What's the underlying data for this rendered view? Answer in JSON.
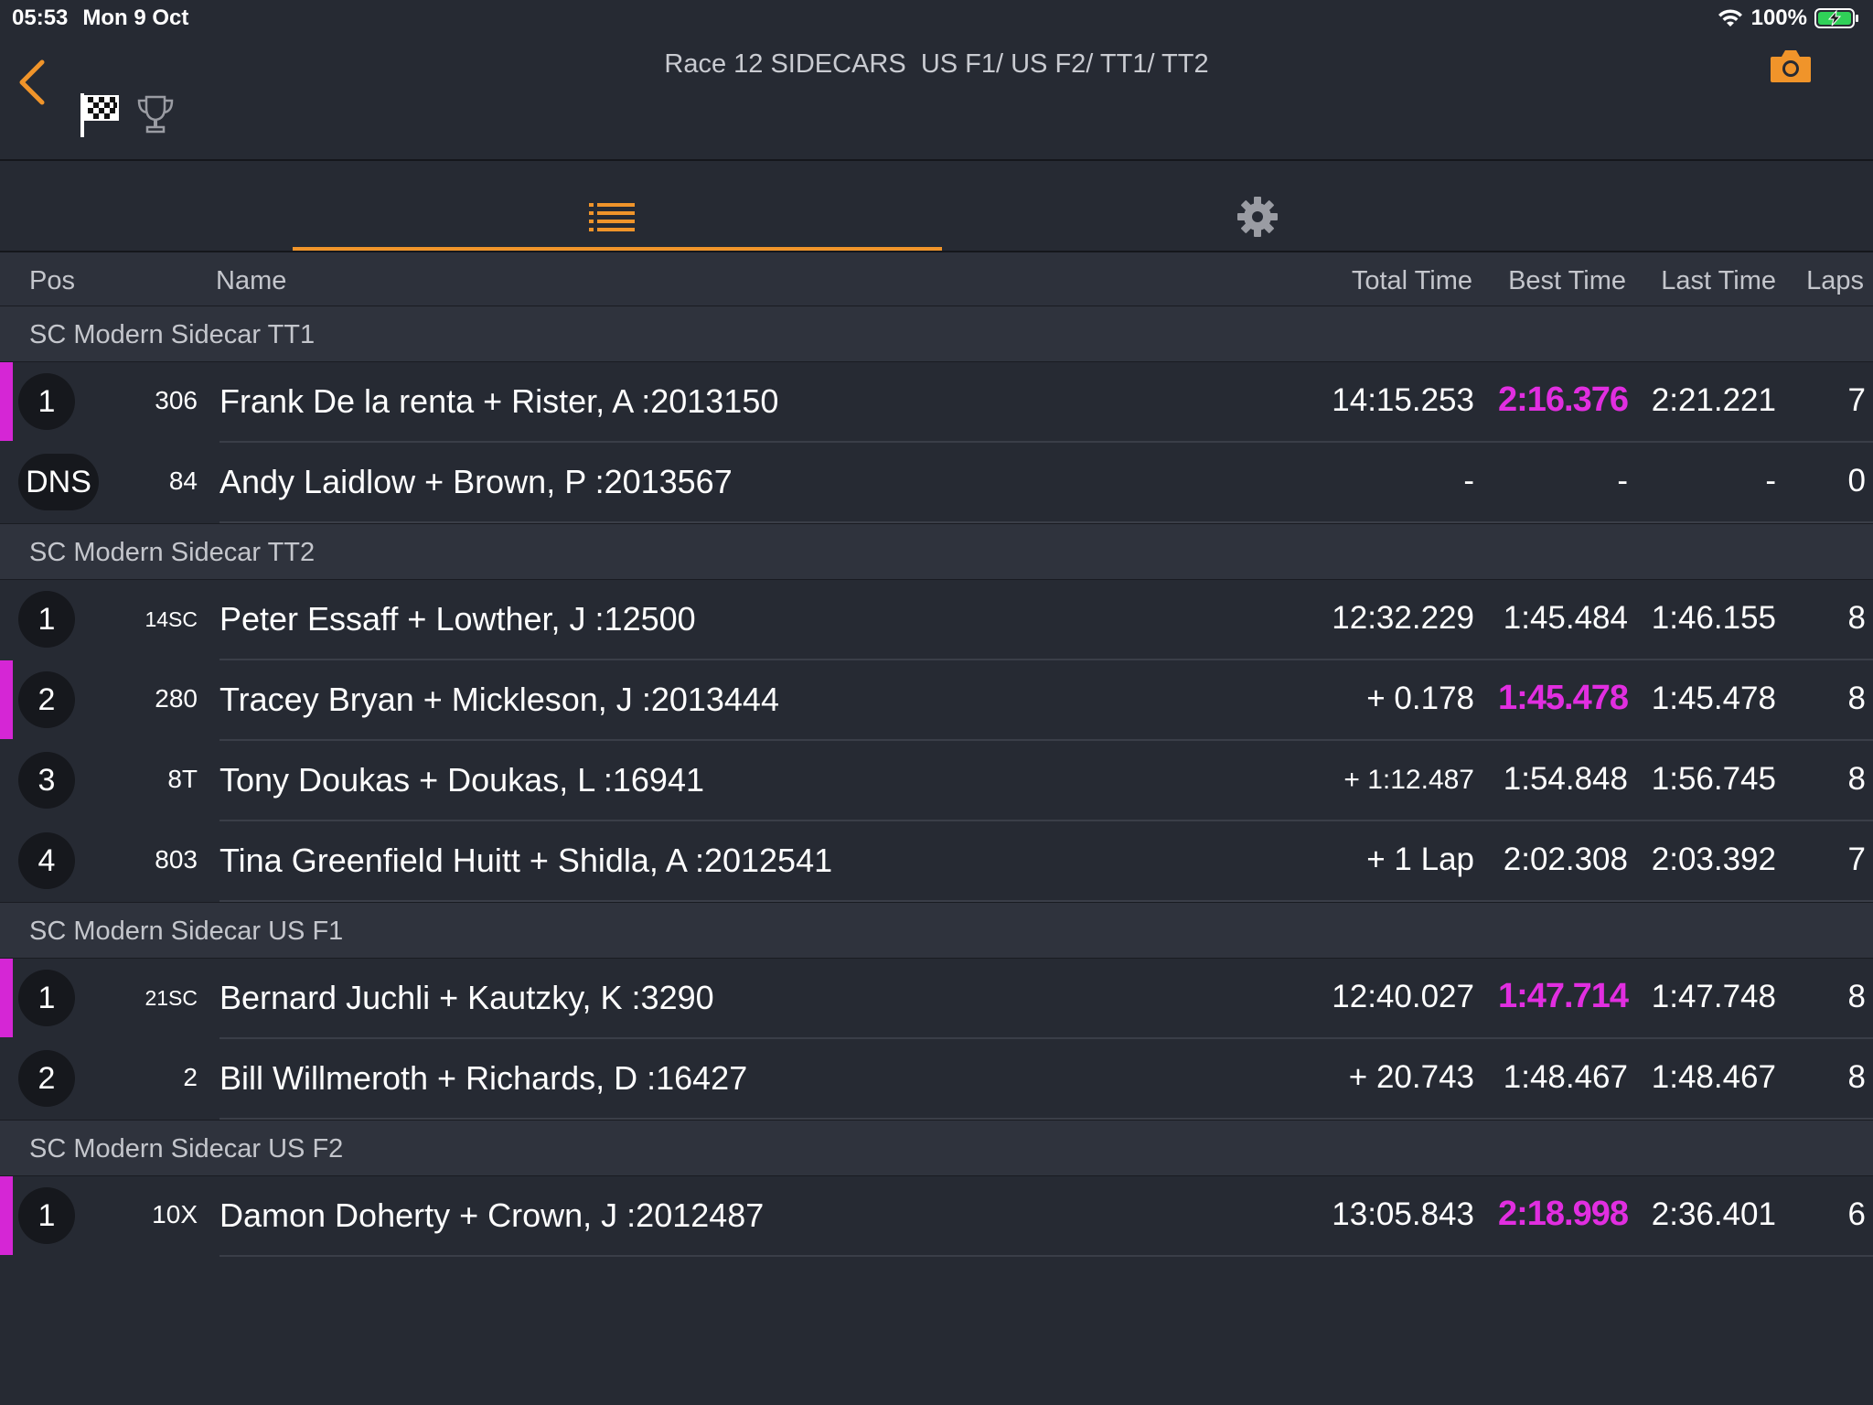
{
  "status_bar": {
    "time": "05:53",
    "date": "Mon 9 Oct",
    "battery": "100%"
  },
  "header": {
    "title": "Race 12 SIDECARS  US F1/ US F2/ TT1/ TT2"
  },
  "columns": {
    "pos": "Pos",
    "name": "Name",
    "total": "Total Time",
    "best": "Best Time",
    "last": "Last Time",
    "laps": "Laps"
  },
  "colors": {
    "accent": "#f0942a",
    "fastest": "#e12ee0",
    "background": "#262a33"
  },
  "classes": [
    {
      "name": "SC Modern Sidecar TT1",
      "rows": [
        {
          "pos": "1",
          "number": "306",
          "name": "Frank De la renta + Rister, A :2013150",
          "total": "14:15.253",
          "best": "2:16.376",
          "last": "2:21.221",
          "laps": "7",
          "fastest": true
        },
        {
          "pos": "DNS",
          "number": "84",
          "name": "Andy Laidlow + Brown, P :2013567",
          "total": "-",
          "best": "-",
          "last": "-",
          "laps": "0",
          "fastest": false
        }
      ]
    },
    {
      "name": "SC Modern Sidecar TT2",
      "rows": [
        {
          "pos": "1",
          "number": "14SC",
          "name": "Peter Essaff + Lowther, J :12500",
          "total": "12:32.229",
          "best": "1:45.484",
          "last": "1:46.155",
          "laps": "8",
          "fastest": false
        },
        {
          "pos": "2",
          "number": "280",
          "name": "Tracey Bryan + Mickleson, J :2013444",
          "total": "+ 0.178",
          "best": "1:45.478",
          "last": "1:45.478",
          "laps": "8",
          "fastest": true
        },
        {
          "pos": "3",
          "number": "8T",
          "name": "Tony Doukas + Doukas, L :16941",
          "total": "+ 1:12.487",
          "best": "1:54.848",
          "last": "1:56.745",
          "laps": "8",
          "fastest": false
        },
        {
          "pos": "4",
          "number": "803",
          "name": "Tina Greenfield Huitt + Shidla, A :2012541",
          "total": "+ 1 Lap",
          "best": "2:02.308",
          "last": "2:03.392",
          "laps": "7",
          "fastest": false
        }
      ]
    },
    {
      "name": "SC Modern Sidecar US F1",
      "rows": [
        {
          "pos": "1",
          "number": "21SC",
          "name": "Bernard Juchli + Kautzky, K :3290",
          "total": "12:40.027",
          "best": "1:47.714",
          "last": "1:47.748",
          "laps": "8",
          "fastest": true
        },
        {
          "pos": "2",
          "number": "2",
          "name": "Bill Willmeroth + Richards, D :16427",
          "total": "+ 20.743",
          "best": "1:48.467",
          "last": "1:48.467",
          "laps": "8",
          "fastest": false
        }
      ]
    },
    {
      "name": "SC Modern Sidecar US F2",
      "rows": [
        {
          "pos": "1",
          "number": "10X",
          "name": "Damon Doherty + Crown, J :2012487",
          "total": "13:05.843",
          "best": "2:18.998",
          "last": "2:36.401",
          "laps": "6",
          "fastest": true
        }
      ]
    }
  ]
}
